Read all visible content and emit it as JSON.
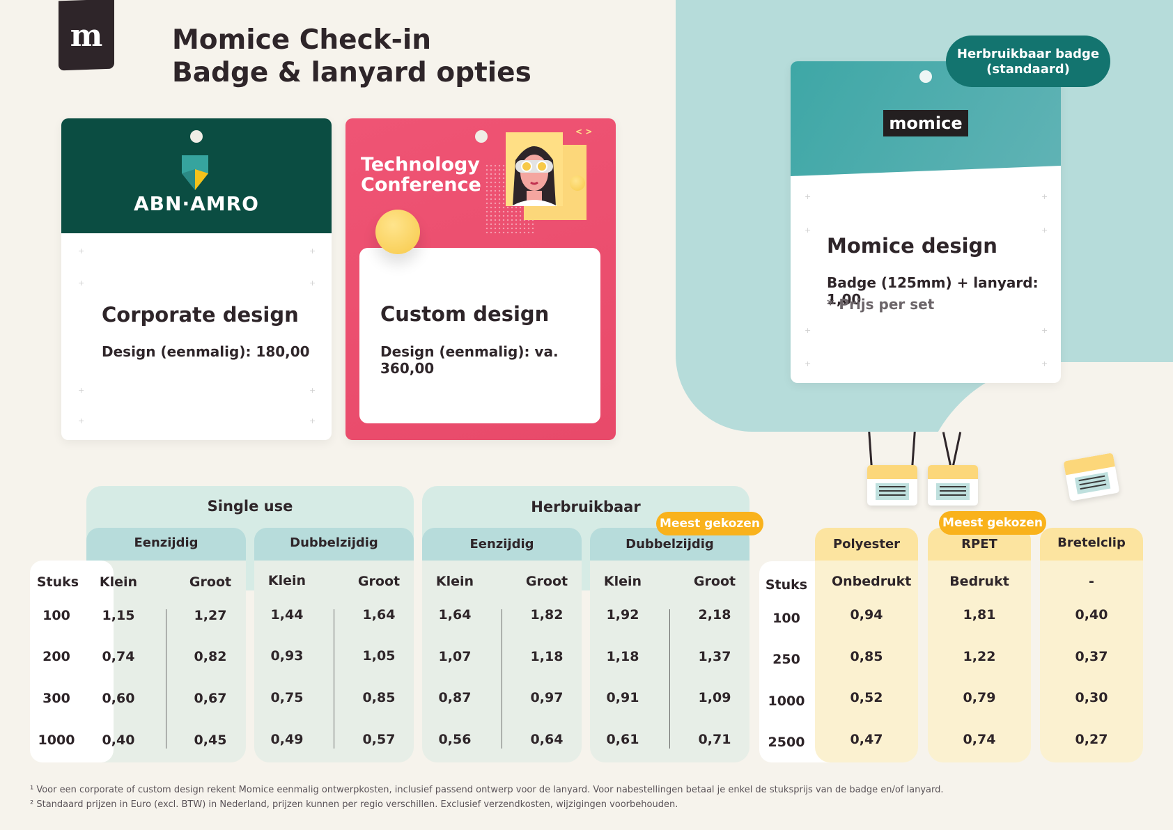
{
  "title": {
    "line1": "Momice Check-in",
    "line2": "Badge & lanyard opties"
  },
  "logo": {
    "letter": "m"
  },
  "cards": {
    "corporate": {
      "brand": "ABN·AMRO",
      "heading": "Corporate design",
      "price": "Design (eenmalig): 180,00"
    },
    "custom": {
      "brand_line1": "Technology",
      "brand_line2": "Conference",
      "code": "< >",
      "heading": "Custom design",
      "price": "Design (eenmalig): va. 360,00"
    },
    "momice": {
      "brand": "momice",
      "heading": "Momice design",
      "price": "Badge (125mm) + lanyard: 1,00",
      "note": "* Prijs per set",
      "pill": "Herbruikbaar badge (standaard)",
      "pill_line1": "Herbruikbaar badge",
      "pill_line2": "(standaard)"
    }
  },
  "badge_table": {
    "stuks_label": "Stuks",
    "quantities": [
      "100",
      "200",
      "300",
      "1000"
    ],
    "groups": [
      {
        "label": "Single use",
        "subs": [
          {
            "label": "Eenzijdig",
            "cols": [
              "Klein",
              "Groot"
            ],
            "rows": [
              [
                "1,15",
                "1,27"
              ],
              [
                "0,74",
                "0,82"
              ],
              [
                "0,60",
                "0,67"
              ],
              [
                "0,40",
                "0,45"
              ]
            ]
          },
          {
            "label": "Dubbelzijdig",
            "cols": [
              "Klein",
              "Groot"
            ],
            "rows": [
              [
                "1,44",
                "1,64"
              ],
              [
                "0,93",
                "1,05"
              ],
              [
                "0,75",
                "0,85"
              ],
              [
                "0,49",
                "0,57"
              ]
            ]
          }
        ]
      },
      {
        "label": "Herbruikbaar",
        "subs": [
          {
            "label": "Eenzijdig",
            "cols": [
              "Klein",
              "Groot"
            ],
            "rows": [
              [
                "1,64",
                "1,82"
              ],
              [
                "1,07",
                "1,18"
              ],
              [
                "0,87",
                "0,97"
              ],
              [
                "0,56",
                "0,64"
              ]
            ]
          },
          {
            "label": "Dubbelzijdig",
            "cols": [
              "Klein",
              "Groot"
            ],
            "rows": [
              [
                "1,92",
                "2,18"
              ],
              [
                "1,18",
                "1,37"
              ],
              [
                "0,91",
                "1,09"
              ],
              [
                "0,61",
                "0,71"
              ]
            ]
          }
        ]
      }
    ],
    "popular": "Meest gekozen"
  },
  "lanyard_table": {
    "stuks_label": "Stuks",
    "quantities": [
      "100",
      "250",
      "1000",
      "2500"
    ],
    "cols": [
      {
        "label": "Polyester",
        "sub": "Onbedrukt",
        "values": [
          "0,94",
          "0,85",
          "0,52",
          "0,47"
        ]
      },
      {
        "label": "RPET",
        "sub": "Bedrukt",
        "values": [
          "1,81",
          "1,22",
          "0,79",
          "0,74"
        ]
      },
      {
        "label": "Bretelclip",
        "sub": "-",
        "values": [
          "0,40",
          "0,37",
          "0,30",
          "0,27"
        ]
      }
    ],
    "popular": "Meest gekozen"
  },
  "footnotes": [
    "¹ Voor een corporate of custom design rekent Momice eenmalig ontwerpkosten, inclusief passend ontwerp voor de lanyard. Voor nabestellingen betaal je enkel de stuksprijs van de badge en/of lanyard.",
    "² Standaard prijzen in Euro (excl. BTW) in Nederland, prijzen kunnen per regio verschillen. Exclusief verzendkosten, wijzigingen voorbehouden."
  ],
  "colors": {
    "teal": "#b6dcda",
    "dark_teal": "#13746f",
    "pink": "#ec4f6f",
    "abn_green": "#0b4d42",
    "yellow": "#f9b21c"
  }
}
